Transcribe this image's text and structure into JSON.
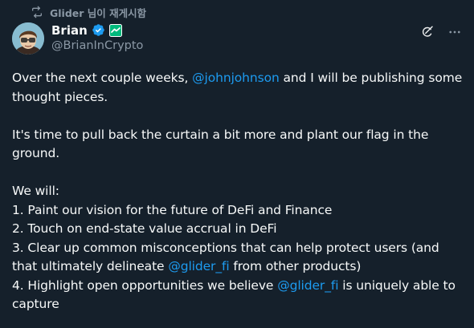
{
  "repost": {
    "text": "Glider 님이 재게시함",
    "icon": "repost-icon"
  },
  "author": {
    "name": "Brian",
    "handle": "@BrianInCrypto",
    "avatar_icon": "avatar-image",
    "verified_icon": "verified-badge-icon",
    "affiliation_icon": "affiliate-badge-icon"
  },
  "actions": {
    "grok_icon": "grok-icon",
    "more_icon": "more-dots-icon"
  },
  "tweet": {
    "p1_a": "Over the next couple weeks, ",
    "p1_mention": "@johnjohnson",
    "p1_b": " and I will be publishing some",
    "p1_c": "thought pieces.",
    "p2_a": "It's time to pull back the curtain a bit more and plant our flag in the",
    "p2_b": "ground.",
    "p3_intro": "We will:",
    "item1": "1. Paint our vision for the future of DeFi and Finance",
    "item2": "2. Touch on end-state value accrual in DeFi",
    "item3_a": "3. Clear up common misconceptions that can help protect users (and",
    "item3_b1": "that ultimately delineate ",
    "item3_mention": "@glider_fi",
    "item3_b2": " from other products)",
    "item4_a1": "4. Highlight open opportunities we believe ",
    "item4_mention": "@glider_fi",
    "item4_a2": " is uniquely able to",
    "item4_b": "capture"
  },
  "colors": {
    "background": "#15202b",
    "text": "#f7f9f9",
    "secondary": "#8b98a5",
    "link": "#1d9bf0",
    "verified": "#1d9bf0",
    "affiliate": "#00ba7c"
  }
}
